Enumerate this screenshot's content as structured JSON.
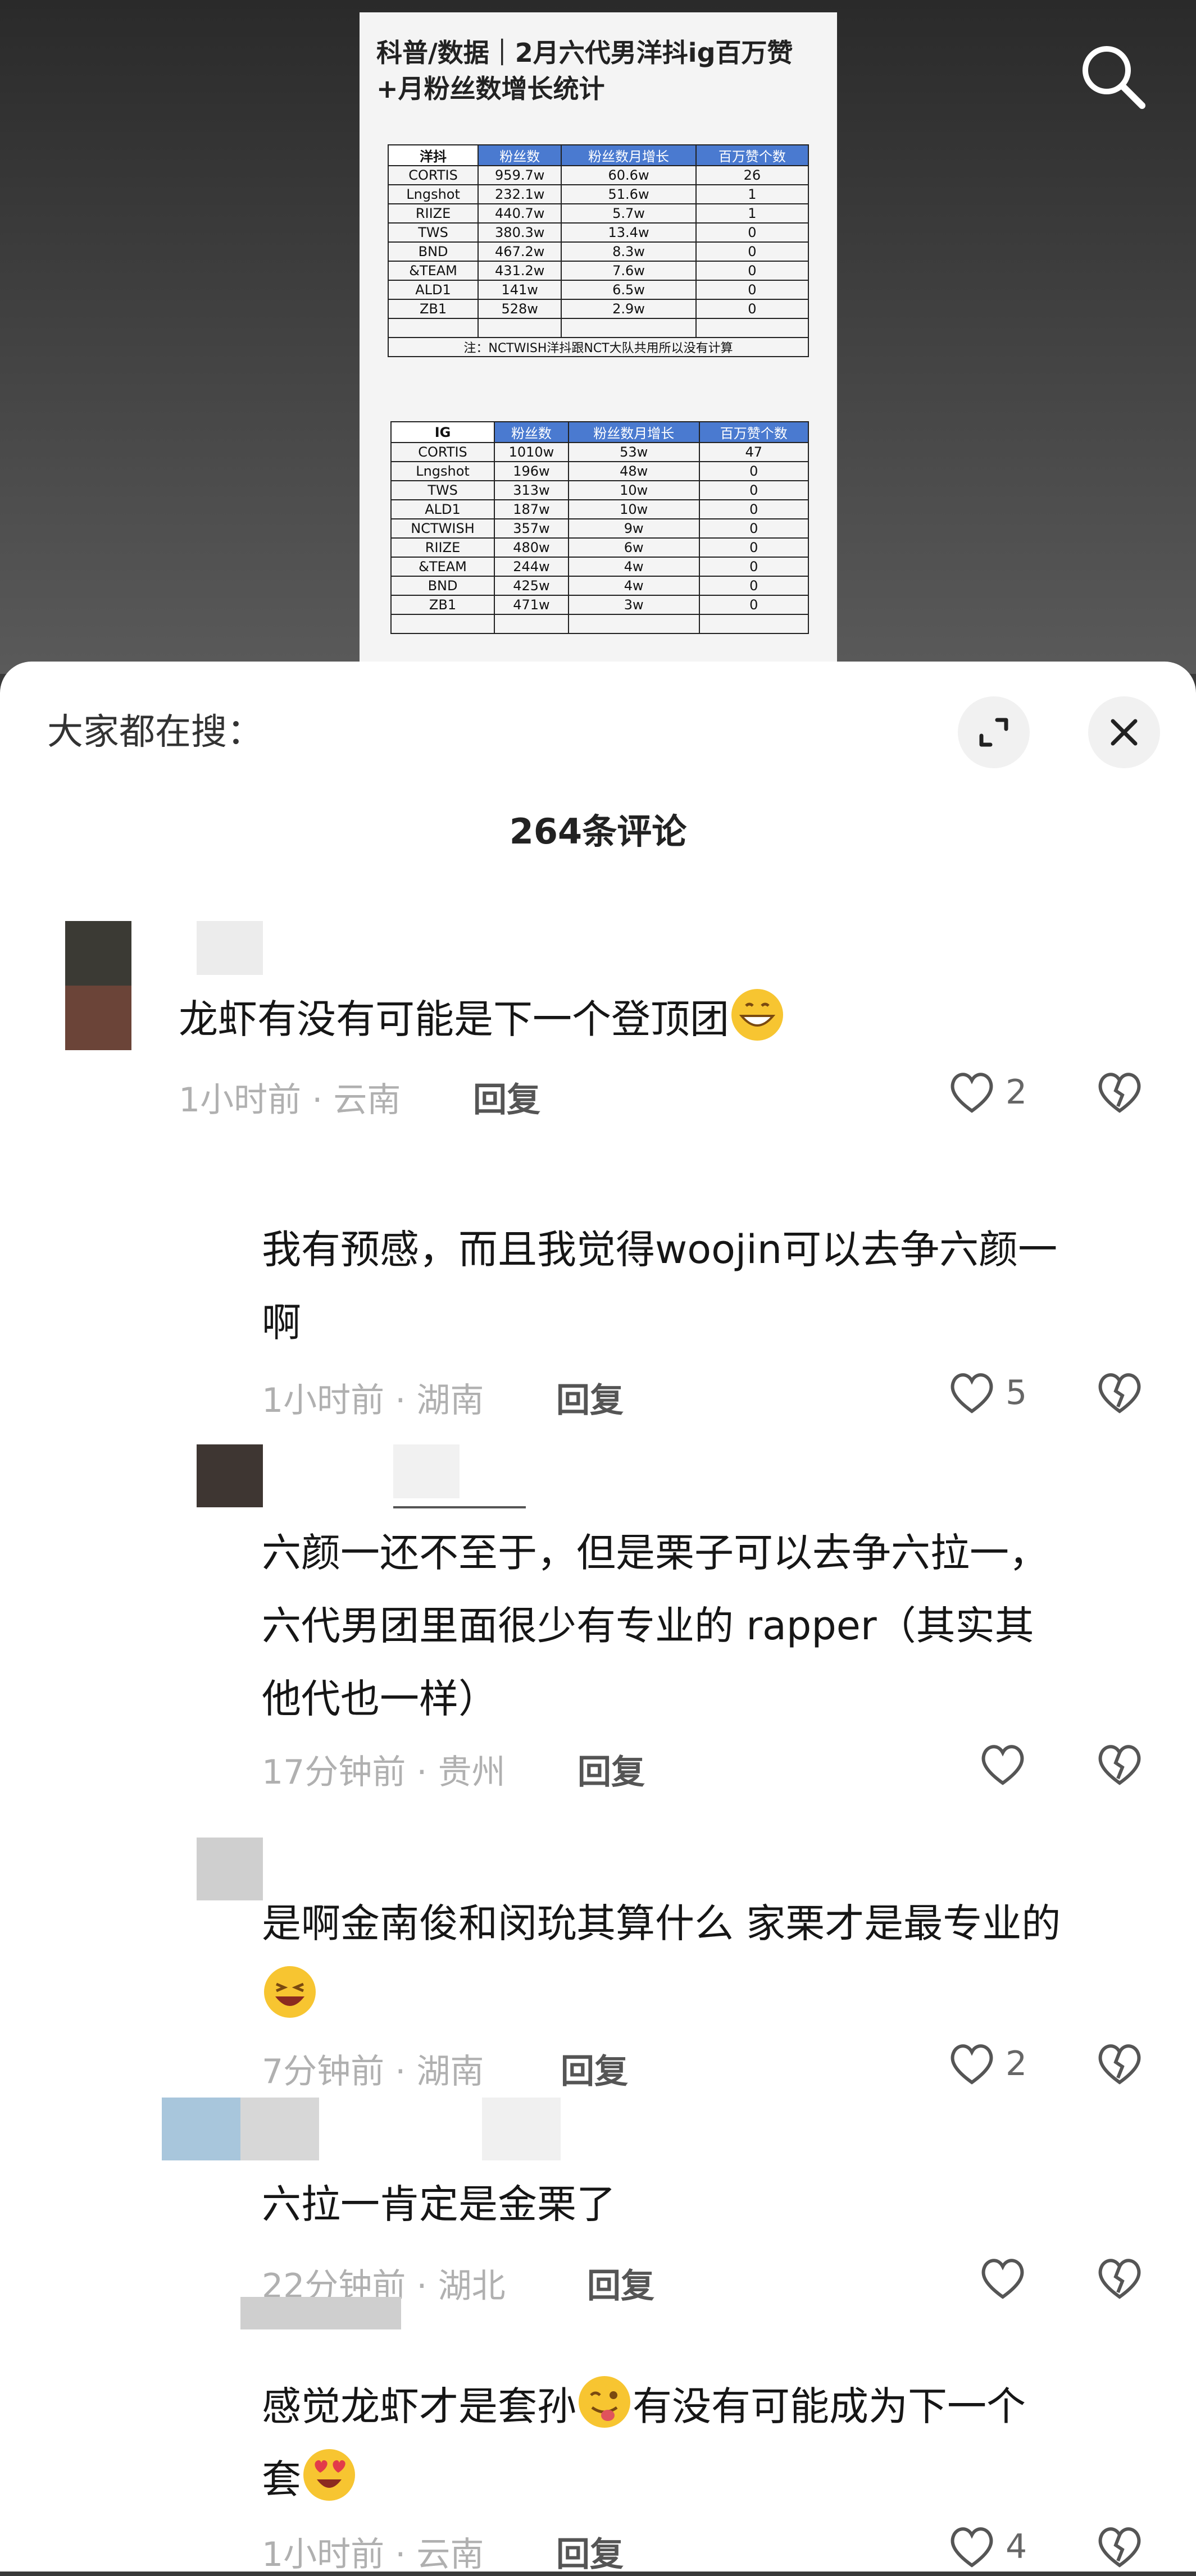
{
  "poster": {
    "title_line1": "科普/数据｜2月六代男洋抖ig百万赞",
    "title_line2": "+月粉丝数增长统计",
    "table1": {
      "headers": [
        "洋抖",
        "粉丝数",
        "粉丝数月增长",
        "百万赞个数"
      ],
      "rows": [
        [
          "CORTIS",
          "959.7w",
          "60.6w",
          "26"
        ],
        [
          "Lngshot",
          "232.1w",
          "51.6w",
          "1"
        ],
        [
          "RIIZE",
          "440.7w",
          "5.7w",
          "1"
        ],
        [
          "TWS",
          "380.3w",
          "13.4w",
          "0"
        ],
        [
          "BND",
          "467.2w",
          "8.3w",
          "0"
        ],
        [
          "&TEAM",
          "431.2w",
          "7.6w",
          "0"
        ],
        [
          "ALD1",
          "141w",
          "6.5w",
          "0"
        ],
        [
          "ZB1",
          "528w",
          "2.9w",
          "0"
        ]
      ],
      "note": "注：NCTWISH洋抖跟NCT大队共用所以没有计算"
    },
    "table2": {
      "headers": [
        "IG",
        "粉丝数",
        "粉丝数月增长",
        "百万赞个数"
      ],
      "rows": [
        [
          "CORTIS",
          "1010w",
          "53w",
          "47"
        ],
        [
          "Lngshot",
          "196w",
          "48w",
          "0"
        ],
        [
          "TWS",
          "313w",
          "10w",
          "0"
        ],
        [
          "ALD1",
          "187w",
          "10w",
          "0"
        ],
        [
          "NCTWISH",
          "357w",
          "9w",
          "0"
        ],
        [
          "RIIZE",
          "480w",
          "6w",
          "0"
        ],
        [
          "&TEAM",
          "244w",
          "4w",
          "0"
        ],
        [
          "BND",
          "425w",
          "4w",
          "0"
        ],
        [
          "ZB1",
          "471w",
          "3w",
          "0"
        ]
      ]
    }
  },
  "sheet": {
    "search_label": "大家都在搜：",
    "comment_count": "264条评论"
  },
  "comments": [
    {
      "text": "龙虾有没有可能是下一个登顶团",
      "meta": "1小时前 · 云南",
      "reply": "回复",
      "likes": "2"
    },
    {
      "text1": "我有预感，而且我觉得woojin可以去争六颜一",
      "text2": "啊",
      "meta": "1小时前 · 湖南",
      "reply": "回复",
      "likes": "5"
    },
    {
      "text1": "六颜一还不至于，但是栗子可以去争六拉一，",
      "text2": "六代男团里面很少有专业的 rapper（其实其",
      "text3": "他代也一样）",
      "meta": "17分钟前 · 贵州",
      "reply": "回复",
      "likes": ""
    },
    {
      "text1": "是啊金南俊和闵玧其算什么 家栗才是最专业的",
      "meta": "7分钟前 · 湖南",
      "reply": "回复",
      "likes": "2"
    },
    {
      "text": "六拉一肯定是金栗了",
      "meta": "22分钟前 · 湖北",
      "reply": "回复",
      "likes": ""
    },
    {
      "text1a": "感觉龙虾才是套孙",
      "text1b": "有没有可能成为下一个",
      "text2": "套",
      "meta": "1小时前 · 云南",
      "reply": "回复",
      "likes": "4"
    }
  ],
  "colors": {
    "accent_blue": "#4a7ad0",
    "meta_gray": "#b0b0b0"
  }
}
